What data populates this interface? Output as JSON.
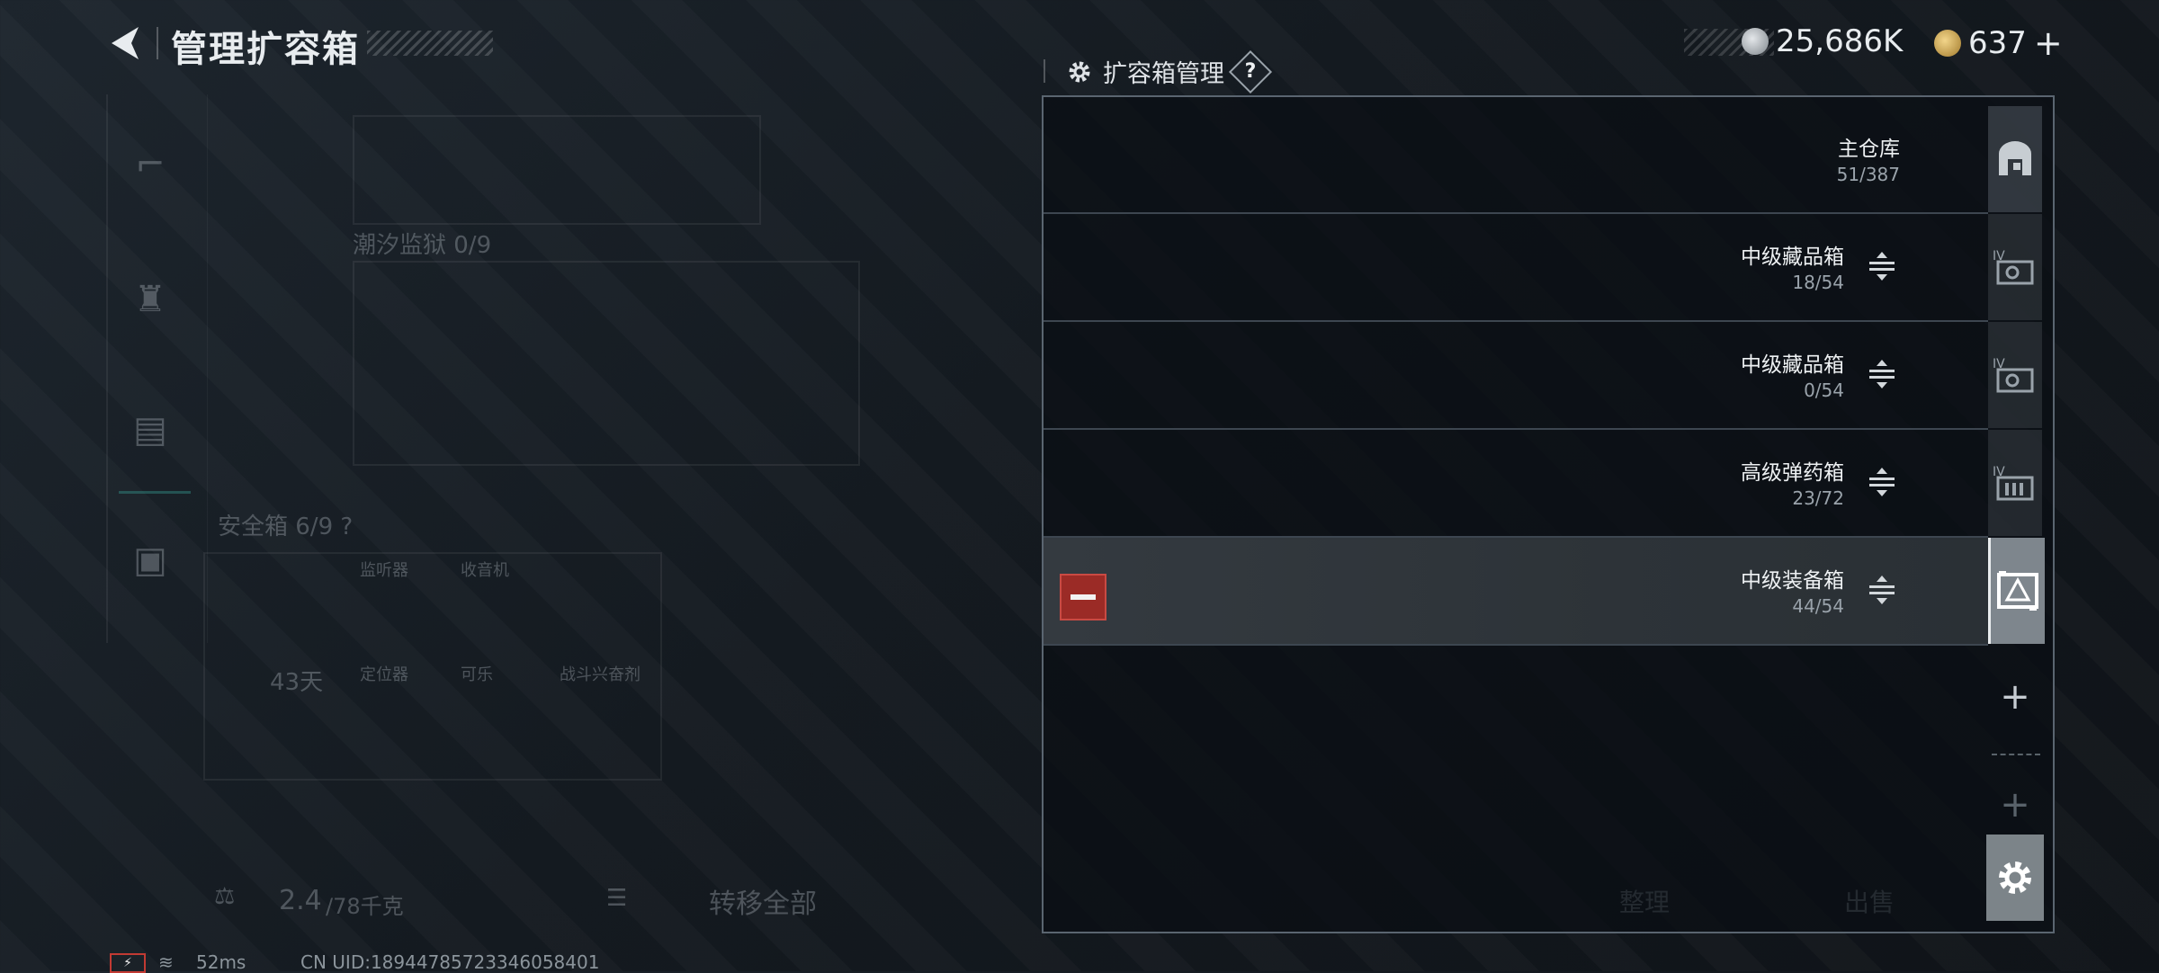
{
  "header": {
    "title": "管理扩容箱",
    "currency_silver": "25,686K",
    "currency_gold": "637",
    "add_symbol": "+"
  },
  "left_panel": {
    "tide_monitor": "潮汐监狱 0/9",
    "safe_box": "安全箱 6/9 ?",
    "safe_box_days": "43天",
    "items": [
      "监听器",
      "收音机",
      "定位器",
      "可乐",
      "战斗兴奋剂"
    ],
    "weight": "2.4",
    "weight_limit": "/78千克",
    "transfer_all": "转移全部",
    "sort": "整理",
    "sell": "出售"
  },
  "panel": {
    "title": "扩容箱管理",
    "help": "?",
    "rows": [
      {
        "name": "主仓库",
        "count": "51/387"
      },
      {
        "name": "中级藏品箱",
        "count": "18/54"
      },
      {
        "name": "中级藏品箱",
        "count": "0/54"
      },
      {
        "name": "高级弹药箱",
        "count": "23/72"
      },
      {
        "name": "中级装备箱",
        "count": "44/54"
      }
    ],
    "add_symbol": "+"
  },
  "status_bar": {
    "ping": "52ms",
    "uid": "CN UID:18944785723346058401"
  },
  "colors": {
    "remove_red": "#9b2b26",
    "selected_tab": "#7e868d",
    "panel_border": "#5a6570"
  }
}
